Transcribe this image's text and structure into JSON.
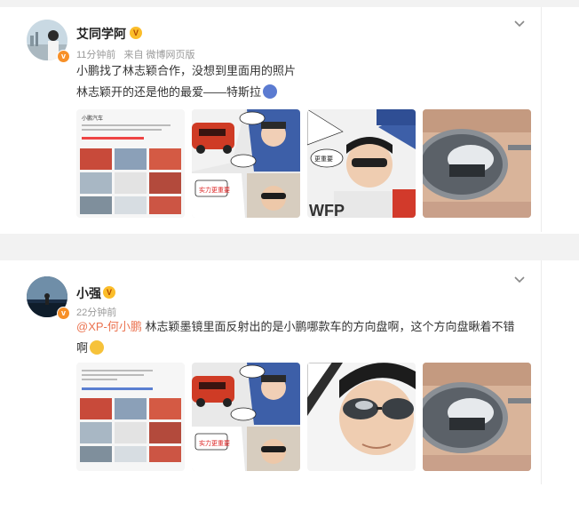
{
  "posts": [
    {
      "username": "艾同学阿",
      "time": "11分钟前",
      "source": "来自 微博网页版",
      "line1": "小鹏找了林志颖合作，没想到里面用的照片",
      "line2": "林志颖开的还是他的最爱——特斯拉",
      "images": [
        "ad-poster-grid",
        "comic-car-panel",
        "driver-closeup",
        "sunglasses-reflection"
      ],
      "mini_title": "小鹏汽车",
      "bubble1": "实力更重要",
      "bubble2": "更重要"
    },
    {
      "username": "小强",
      "time": "22分钟前",
      "mention": "@XP-何小鹏",
      "text": " 林志颖墨镜里面反射出的是小鹏哪款车的方向盘啊，这个方向盘瞅着不错",
      "line2": "啊",
      "images": [
        "ad-poster-grid",
        "comic-car-panel",
        "driver-closeup",
        "sunglasses-reflection"
      ],
      "mini_title": "",
      "bubble1": "实力更重要"
    }
  ],
  "colors": {
    "mention": "#eb7350",
    "badge": "#f79028",
    "level": "#fbbd2a"
  }
}
